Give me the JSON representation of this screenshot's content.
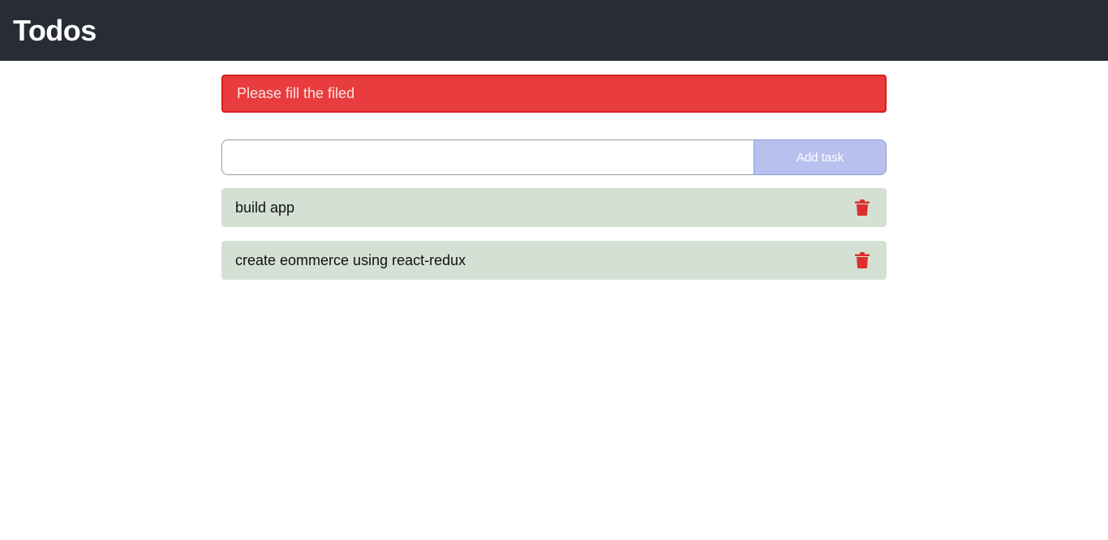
{
  "header": {
    "title": "Todos"
  },
  "alert": {
    "message": "Please fill the filed",
    "color": "#e83c3e"
  },
  "form": {
    "input_value": "",
    "input_placeholder": "",
    "add_button_label": "Add task"
  },
  "tasks": [
    {
      "text": "build app",
      "action_icon": "trash-icon"
    },
    {
      "text": "create eommerce using react-redux",
      "action_icon": "trash-icon"
    }
  ],
  "colors": {
    "navbar": "#282c34",
    "task_bg": "#d4e0d4",
    "delete_icon": "#dc2f2f",
    "add_button": "#b8c1ee"
  }
}
